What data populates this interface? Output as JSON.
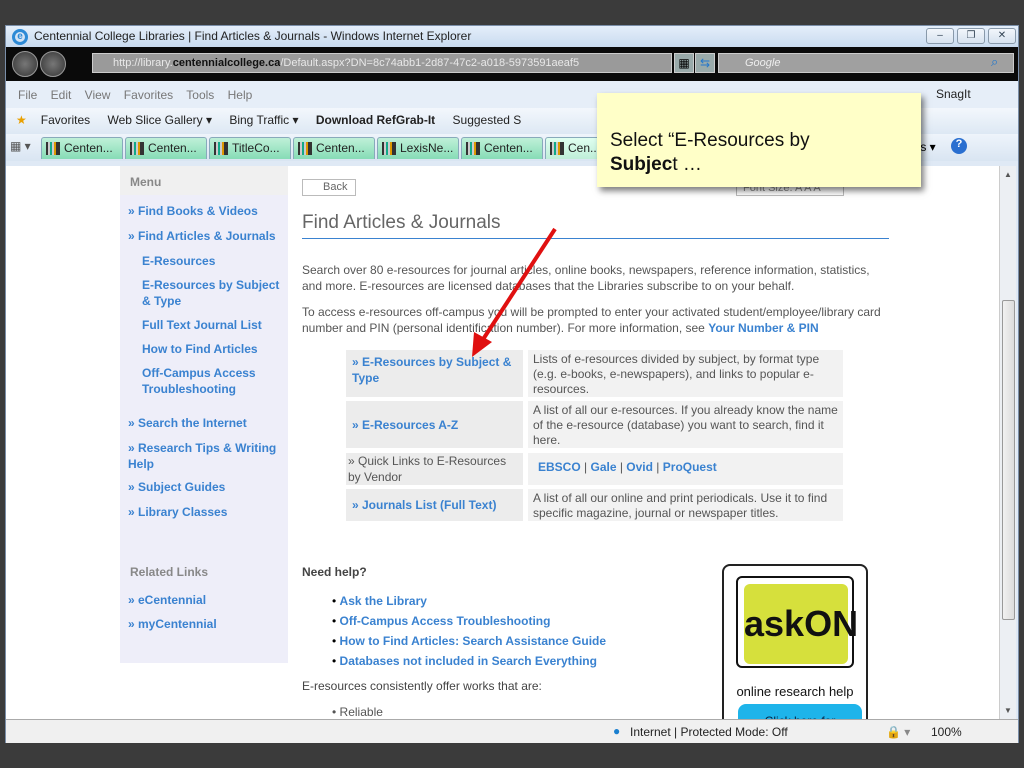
{
  "window": {
    "title": "Centennial College Libraries | Find Articles & Journals - Windows Internet Explorer",
    "min": "–",
    "restore": "❐",
    "close": "✕"
  },
  "address": {
    "url_pre": "http://library.",
    "url_domain": "centennialcollege.ca",
    "url_post": "/Default.aspx?DN=8c74abb1-2d87-47c2-a018-5973591aeaf5",
    "search_placeholder": "Google"
  },
  "menubar": {
    "items": "File  Edit  View  Favorites  Tools  Help",
    "snagit": "SnagIt"
  },
  "favorites": {
    "label": "Favorites",
    "items": [
      "Web Slice Gallery ▾",
      "Bing Traffic ▾",
      "Download RefGrab-It",
      "Suggested S"
    ]
  },
  "tabs": [
    "Centen...",
    "Centen...",
    "TitleCo...",
    "Centen...",
    "LexisNe...",
    "Centen...",
    "Cen..."
  ],
  "tools": "ols ▾",
  "callout": {
    "line1": "Select “E-Resources by",
    "bold": "Subjec",
    "rest": "t …"
  },
  "sidebar": {
    "menu_header": "Menu",
    "items": [
      "» Find Books & Videos",
      "» Find Articles & Journals",
      "E-Resources",
      "E-Resources by Subject & Type",
      "Full Text Journal List",
      "How to Find Articles",
      "Off-Campus Access Troubleshooting",
      "» Search the Internet",
      "» Research Tips & Writing Help",
      "» Subject Guides",
      "» Library Classes"
    ],
    "related_header": "Related Links",
    "related": [
      "» eCentennial",
      "» myCentennial"
    ]
  },
  "main": {
    "back": "Back",
    "font_size": "Font Size: A A A",
    "title": "Find Articles & Journals",
    "p1": "Search over 80 e-resources for journal articles, online books, newspapers, reference information, statistics, and more. E-resources are licensed databases that the Libraries subscribe to on your behalf.",
    "p2": "To access e-resources off-campus you will be prompted to enter your activated student/employee/library card number and PIN (personal identification number). For more information, see ",
    "p2_link": "Your Number & PIN",
    "table": [
      {
        "link": "» E-Resources by Subject & Type",
        "desc": "Lists of e-resources divided by subject, by format type (e.g. e-books, e-newspapers), and links to popular e-resources."
      },
      {
        "link": "» E-Resources A-Z",
        "desc": "A list of all our e-resources. If you already know the name of the e-resource (database) you want to search, find it here."
      },
      {
        "label": "» Quick Links to E-Resources by Vendor",
        "vendors": [
          "EBSCO",
          "Gale",
          "Ovid",
          "ProQuest"
        ]
      },
      {
        "link": "» Journals List (Full Text)",
        "desc": "A list of all our online and print periodicals. Use it to find specific magazine, journal or newspaper titles."
      }
    ],
    "need_help": "Need help?",
    "help_links": [
      "Ask the Library",
      "Off-Campus Access Troubleshooting",
      "How to Find Articles: Search Assistance Guide",
      "Databases not included in Search Everything"
    ],
    "consistently": "E-resources consistently offer works that are:",
    "bullets": [
      "Reliable"
    ],
    "askon": {
      "logo": "askON",
      "tagline": "online research help",
      "button": "Click here for"
    }
  },
  "status": {
    "zone": "Internet | Protected Mode: Off",
    "zoom": "100%"
  }
}
